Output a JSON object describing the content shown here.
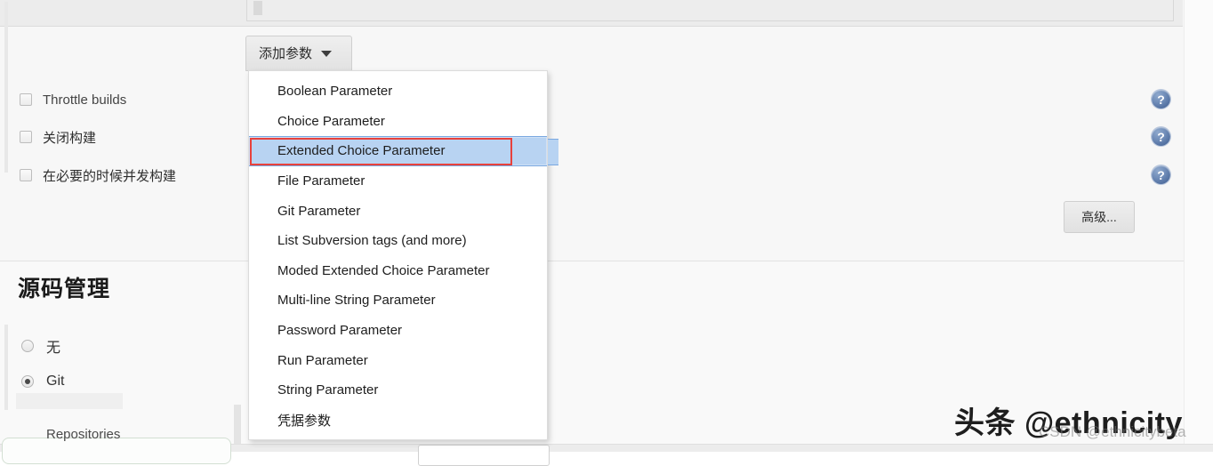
{
  "config_panel": {
    "add_parameter_button": {
      "label": "添加参数",
      "caret_icon": "chevron-down-icon"
    }
  },
  "dropdown": {
    "items": [
      {
        "label": "Boolean Parameter",
        "selected": false,
        "cjk": false
      },
      {
        "label": "Choice Parameter",
        "selected": false,
        "cjk": false
      },
      {
        "label": "Extended Choice Parameter",
        "selected": true,
        "cjk": false
      },
      {
        "label": "File Parameter",
        "selected": false,
        "cjk": false
      },
      {
        "label": "Git Parameter",
        "selected": false,
        "cjk": false
      },
      {
        "label": "List Subversion tags (and more)",
        "selected": false,
        "cjk": false
      },
      {
        "label": "Moded Extended Choice Parameter",
        "selected": false,
        "cjk": false
      },
      {
        "label": "Multi-line String Parameter",
        "selected": false,
        "cjk": false
      },
      {
        "label": "Password Parameter",
        "selected": false,
        "cjk": false
      },
      {
        "label": "Run Parameter",
        "selected": false,
        "cjk": false
      },
      {
        "label": "String Parameter",
        "selected": false,
        "cjk": false
      },
      {
        "label": "凭据参数",
        "selected": false,
        "cjk": true
      }
    ]
  },
  "build_triggers": {
    "checkboxes": [
      {
        "label": "Throttle builds",
        "checked": false,
        "cjk": false
      },
      {
        "label": "关闭构建",
        "checked": false,
        "cjk": true
      },
      {
        "label": "在必要的时候并发构建",
        "checked": false,
        "cjk": true
      }
    ],
    "help_icons": [
      {
        "name": "help-icon",
        "glyph": "?"
      },
      {
        "name": "help-icon",
        "glyph": "?"
      },
      {
        "name": "help-icon",
        "glyph": "?"
      }
    ],
    "advanced_button_label": "高级..."
  },
  "source_code_management": {
    "heading": "源码管理",
    "radios": [
      {
        "label": "无",
        "checked": false
      },
      {
        "label": "Git",
        "checked": true
      }
    ],
    "repositories_label": "Repositories"
  },
  "watermarks": {
    "toutiao": "头条 @ethnicity",
    "csdn": "CSDN @ethnicitybeta"
  },
  "colors": {
    "selection_fill": "#b8d3f2",
    "selection_border": "#7aa8e0",
    "annotation_red": "#e8413c",
    "help_icon_blue": "#4f6d9e",
    "page_background": "#f7f7f7"
  }
}
